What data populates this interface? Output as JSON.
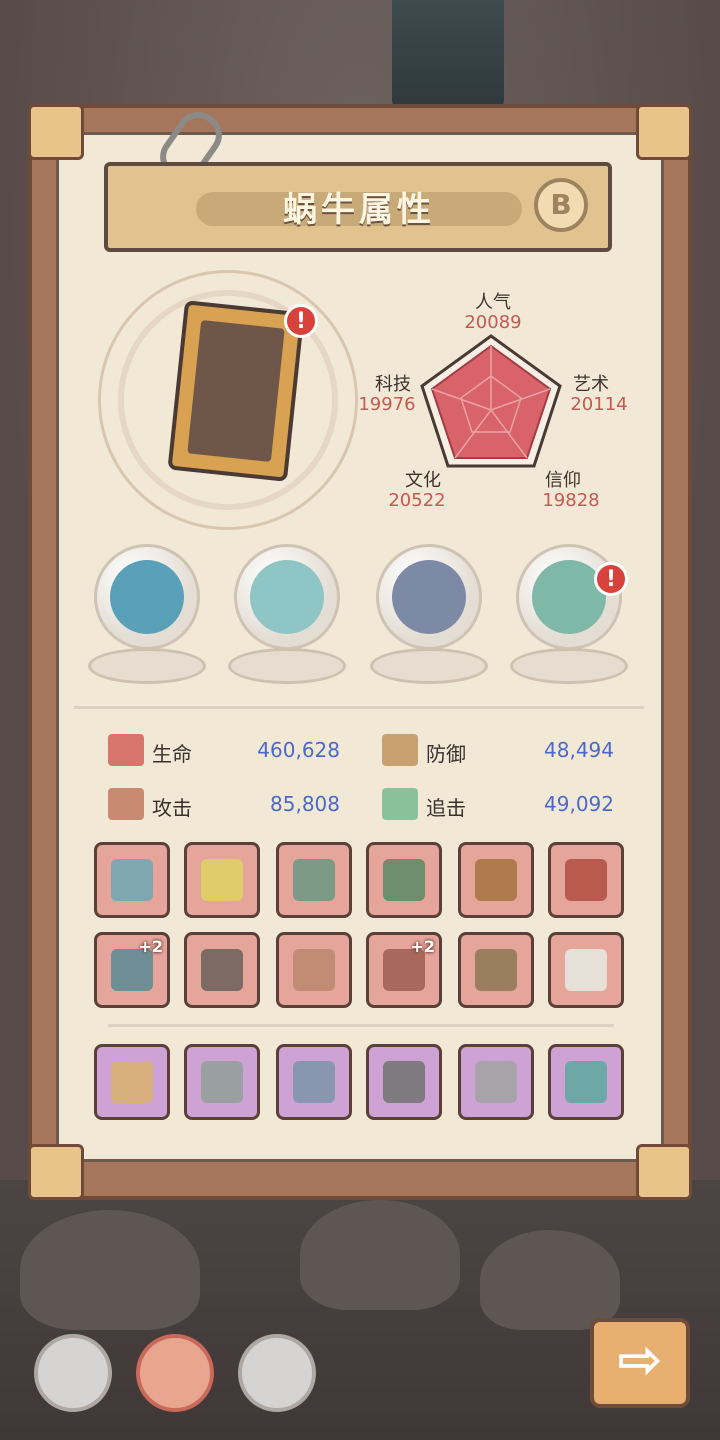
{
  "title": "蜗牛属性",
  "grade": "B",
  "alert_glyph": "!",
  "stats": [
    {
      "name": "人气",
      "value": "20089"
    },
    {
      "name": "艺术",
      "value": "20114"
    },
    {
      "name": "信仰",
      "value": "19828"
    },
    {
      "name": "文化",
      "value": "20522"
    },
    {
      "name": "科技",
      "value": "19976"
    }
  ],
  "attributes": [
    {
      "name": "生命",
      "value": "460,628"
    },
    {
      "name": "防御",
      "value": "48,494"
    },
    {
      "name": "攻击",
      "value": "85,808"
    },
    {
      "name": "追击",
      "value": "49,092"
    }
  ],
  "equipment": [
    {
      "icon": "monster-jaw-icon",
      "color": "#5aa0b8",
      "alert": false
    },
    {
      "icon": "plaid-shirt-icon",
      "color": "#8fc6c5",
      "alert": false
    },
    {
      "icon": "compass-icon",
      "color": "#7d8aa5",
      "alert": false
    },
    {
      "icon": "portal-ring-icon",
      "color": "#7fb8a6",
      "alert": true
    }
  ],
  "slots_row1": [
    {
      "icon": "sword-icon",
      "color": "#7fa7b2",
      "plus": ""
    },
    {
      "icon": "axe-icon",
      "color": "#e0cc6a",
      "plus": ""
    },
    {
      "icon": "hammer-icon",
      "color": "#7d9a86",
      "plus": ""
    },
    {
      "icon": "dragon-staff-icon",
      "color": "#6e8e6e",
      "plus": ""
    },
    {
      "icon": "crossbow-icon",
      "color": "#b07a4e",
      "plus": ""
    },
    {
      "icon": "lance-icon",
      "color": "#b85a4e",
      "plus": ""
    }
  ],
  "slots_row2": [
    {
      "icon": "dagger-icon",
      "color": "#6f8f96",
      "plus": "+2"
    },
    {
      "icon": "chest-armor-icon",
      "color": "#7e6a64",
      "plus": ""
    },
    {
      "icon": "cloak-icon",
      "color": "#c28c74",
      "plus": ""
    },
    {
      "icon": "spear-icon",
      "color": "#a9685c",
      "plus": "+2"
    },
    {
      "icon": "ring-icon",
      "color": "#9b7e5e",
      "plus": ""
    },
    {
      "icon": "robe-icon",
      "color": "#e6e0d8",
      "plus": ""
    }
  ],
  "slots_row3": [
    {
      "icon": "treasure-chest-icon",
      "color": "#d8b07e"
    },
    {
      "icon": "katana-icon",
      "color": "#9aa0a0"
    },
    {
      "icon": "gauntlet-icon",
      "color": "#8996b0"
    },
    {
      "icon": "scepter-icon",
      "color": "#7e7a80"
    },
    {
      "icon": "bone-armor-icon",
      "color": "#a6a4a8"
    },
    {
      "icon": "trident-icon",
      "color": "#6ea8a6"
    }
  ],
  "bottom_buttons": [
    {
      "icon": "pet-portrait-icon",
      "active": false
    },
    {
      "icon": "snail-portrait-icon",
      "active": true
    },
    {
      "icon": "machine-portrait-icon",
      "active": false
    }
  ],
  "next_glyph": "⇨"
}
